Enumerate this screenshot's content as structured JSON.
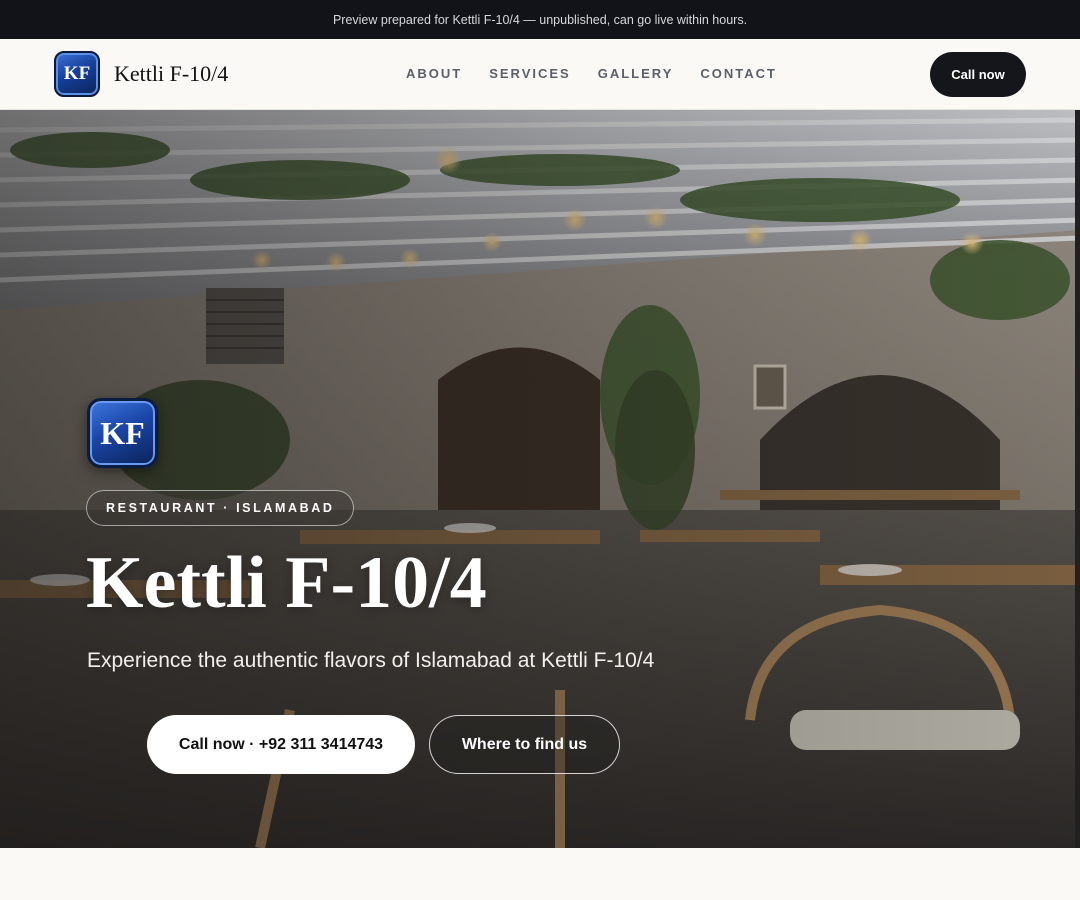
{
  "banner": {
    "text": "Preview prepared for Kettli F-10/4 — unpublished, can go live within hours."
  },
  "brand": {
    "logo_text": "KF",
    "name": "Kettli F-10/4"
  },
  "nav": {
    "links": [
      {
        "label": "ABOUT"
      },
      {
        "label": "SERVICES"
      },
      {
        "label": "GALLERY"
      },
      {
        "label": "CONTACT"
      }
    ],
    "cta_label": "Call now"
  },
  "hero": {
    "logo_text": "KF",
    "tag": "RESTAURANT · ISLAMABAD",
    "title": "Kettli F-10/4",
    "subtitle": "Experience the authentic flavors of Islamabad at Kettli F-10/4",
    "primary_button": "Call now · +92 311 3414743",
    "secondary_button": "Where to find us",
    "image_icon": "restaurant-interior-photo"
  },
  "colors": {
    "banner_bg": "#111318",
    "nav_bg": "#faf9f6",
    "cta_bg": "#14161b",
    "logo_blue": "#17409c"
  }
}
